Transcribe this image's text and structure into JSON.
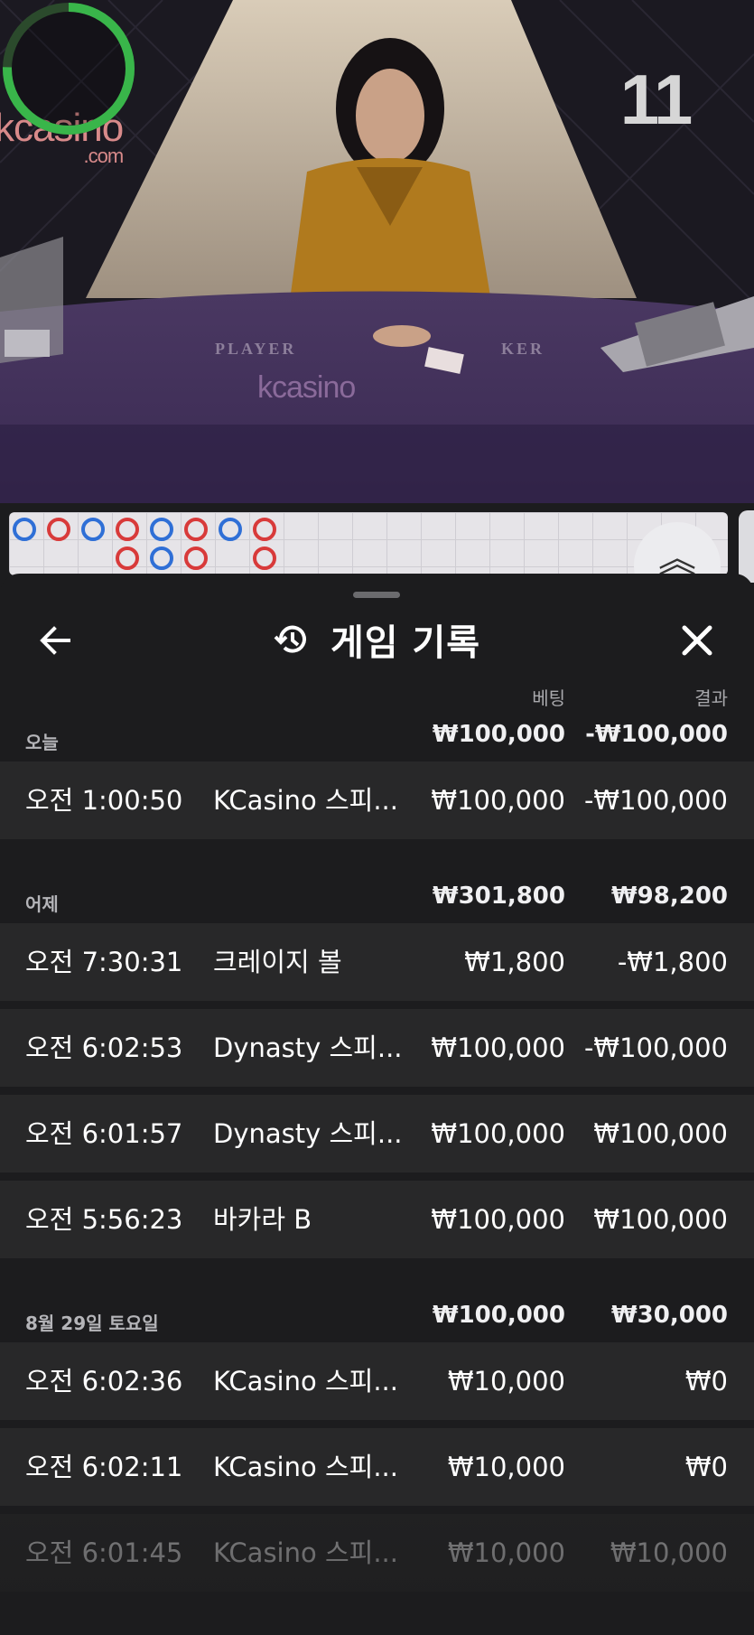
{
  "video": {
    "timer_value": "11",
    "brand_logo_text": "kcasino",
    "brand_logo_domain": ".com",
    "table_label_player": "PLAYER",
    "table_label_banker": "KER"
  },
  "history": {
    "title": "게임 기록",
    "col_bet": "베팅",
    "col_result": "결과",
    "sections": [
      {
        "label": "오늘",
        "total_bet": "₩100,000",
        "total_result": "-₩100,000",
        "rows": [
          {
            "time": "오전 1:00:50",
            "game": "KCasino 스피...",
            "bet": "₩100,000",
            "result": "-₩100,000"
          }
        ]
      },
      {
        "label": "어제",
        "total_bet": "₩301,800",
        "total_result": "₩98,200",
        "rows": [
          {
            "time": "오전 7:30:31",
            "game": "크레이지 볼",
            "bet": "₩1,800",
            "result": "-₩1,800"
          },
          {
            "time": "오전 6:02:53",
            "game": "Dynasty 스피...",
            "bet": "₩100,000",
            "result": "-₩100,000"
          },
          {
            "time": "오전 6:01:57",
            "game": "Dynasty 스피...",
            "bet": "₩100,000",
            "result": "₩100,000"
          },
          {
            "time": "오전 5:56:23",
            "game": "바카라 B",
            "bet": "₩100,000",
            "result": "₩100,000"
          }
        ]
      },
      {
        "label": "8월 29일 토요일",
        "total_bet": "₩100,000",
        "total_result": "₩30,000",
        "rows": [
          {
            "time": "오전 6:02:36",
            "game": "KCasino 스피...",
            "bet": "₩10,000",
            "result": "₩0"
          },
          {
            "time": "오전 6:02:11",
            "game": "KCasino 스피...",
            "bet": "₩10,000",
            "result": "₩0"
          },
          {
            "time": "오전 6:01:45",
            "game": "KCasino 스피...",
            "bet": "₩10,000",
            "result": "₩10,000"
          }
        ]
      }
    ]
  },
  "colors": {
    "sheet_bg": "#1c1c1e",
    "row_bg": "#282829",
    "timer_ring": "#39b54a",
    "bead_player": "#2f6fd6",
    "bead_banker": "#d83a3a"
  },
  "icons": {
    "back": "arrow-left-icon",
    "history": "history-clock-icon",
    "close": "close-icon",
    "scroll": "chevron-double-up-icon"
  }
}
